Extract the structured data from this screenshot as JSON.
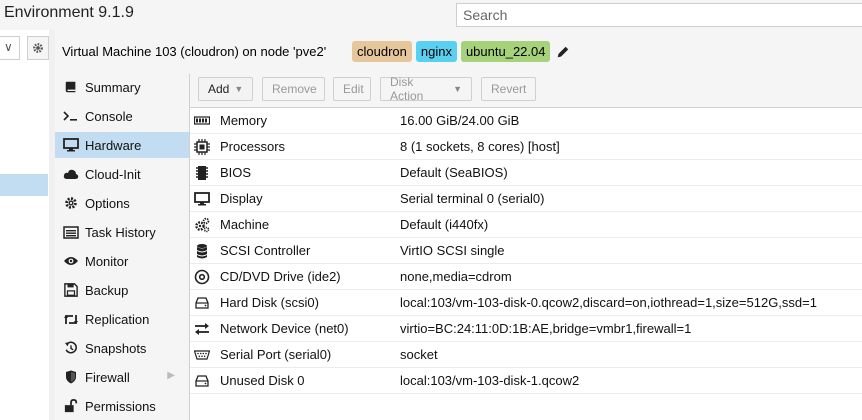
{
  "app": {
    "title": "Environment 9.1.9"
  },
  "search": {
    "placeholder": "Search"
  },
  "tree": {
    "combo_symbol": "∨"
  },
  "vm": {
    "title": "Virtual Machine 103 (cloudron) on node 'pve2'",
    "tags": [
      {
        "label": "cloudron",
        "color": "#e6c79c"
      },
      {
        "label": "nginx",
        "color": "#5ad0f0"
      },
      {
        "label": "ubuntu_22.04",
        "color": "#a6d27c"
      }
    ]
  },
  "nav": {
    "items": [
      {
        "label": "Summary",
        "icon": "book-icon"
      },
      {
        "label": "Console",
        "icon": "terminal-icon"
      },
      {
        "label": "Hardware",
        "icon": "desktop-icon",
        "active": true
      },
      {
        "label": "Cloud-Init",
        "icon": "cloud-icon"
      },
      {
        "label": "Options",
        "icon": "gear-icon"
      },
      {
        "label": "Task History",
        "icon": "list-icon"
      },
      {
        "label": "Monitor",
        "icon": "eye-icon"
      },
      {
        "label": "Backup",
        "icon": "floppy-icon"
      },
      {
        "label": "Replication",
        "icon": "retweet-icon"
      },
      {
        "label": "Snapshots",
        "icon": "history-icon"
      },
      {
        "label": "Firewall",
        "icon": "shield-icon",
        "has_submenu": true
      },
      {
        "label": "Permissions",
        "icon": "unlock-icon"
      }
    ]
  },
  "toolbar": {
    "add_label": "Add",
    "remove_label": "Remove",
    "edit_label": "Edit",
    "disk_action_label": "Disk Action",
    "revert_label": "Revert"
  },
  "hardware": {
    "rows": [
      {
        "key": "Memory",
        "value": "16.00 GiB/24.00 GiB",
        "icon": "memory-icon"
      },
      {
        "key": "Processors",
        "value": "8 (1 sockets, 8 cores) [host]",
        "icon": "cpu-icon"
      },
      {
        "key": "BIOS",
        "value": "Default (SeaBIOS)",
        "icon": "microchip-icon"
      },
      {
        "key": "Display",
        "value": "Serial terminal 0 (serial0)",
        "icon": "monitor-icon"
      },
      {
        "key": "Machine",
        "value": "Default (i440fx)",
        "icon": "cogs-icon"
      },
      {
        "key": "SCSI Controller",
        "value": "VirtIO SCSI single",
        "icon": "database-icon"
      },
      {
        "key": "CD/DVD Drive (ide2)",
        "value": "none,media=cdrom",
        "icon": "cdrom-icon"
      },
      {
        "key": "Hard Disk (scsi0)",
        "value": "local:103/vm-103-disk-0.qcow2,discard=on,iothread=1,size=512G,ssd=1",
        "icon": "hdd-icon"
      },
      {
        "key": "Network Device (net0)",
        "value": "virtio=BC:24:11:0D:1B:AE,bridge=vmbr1,firewall=1",
        "icon": "exchange-icon"
      },
      {
        "key": "Serial Port (serial0)",
        "value": "socket",
        "icon": "serial-port-icon"
      },
      {
        "key": "Unused Disk 0",
        "value": "local:103/vm-103-disk-1.qcow2",
        "icon": "hdd-icon"
      }
    ]
  }
}
